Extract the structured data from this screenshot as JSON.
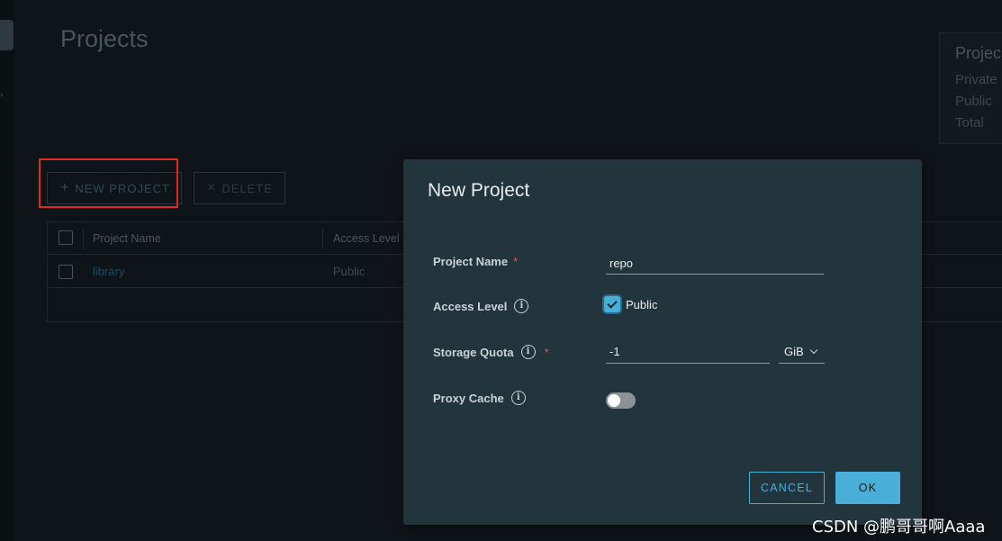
{
  "page": {
    "title": "Projects"
  },
  "summary_card": {
    "title": "Projec",
    "rows": [
      "Private",
      "Public",
      "Total"
    ]
  },
  "toolbar": {
    "new_project_icon": "+",
    "new_project_label": "NEW PROJECT",
    "delete_icon": "×",
    "delete_label": "DELETE"
  },
  "grid": {
    "columns": [
      "Project Name",
      "Access Level"
    ],
    "rows": [
      {
        "name": "library",
        "access": "Public"
      }
    ]
  },
  "modal": {
    "title": "New Project",
    "project_name_label": "Project Name",
    "project_name_value": "repo",
    "access_level_label": "Access Level",
    "public_label": "Public",
    "public_checked": true,
    "storage_quota_label": "Storage Quota",
    "storage_quota_value": "-1",
    "storage_unit": "GiB",
    "proxy_cache_label": "Proxy Cache",
    "proxy_cache_enabled": false,
    "required_mark": "*",
    "info_glyph": "i",
    "cancel_label": "CANCEL",
    "ok_label": "OK"
  },
  "watermark": "CSDN @鹏哥哥啊Aaaa",
  "colors": {
    "accent": "#49afd9",
    "modal_bg": "#22343c",
    "required": "#e0584e",
    "highlight": "#e2281f"
  }
}
